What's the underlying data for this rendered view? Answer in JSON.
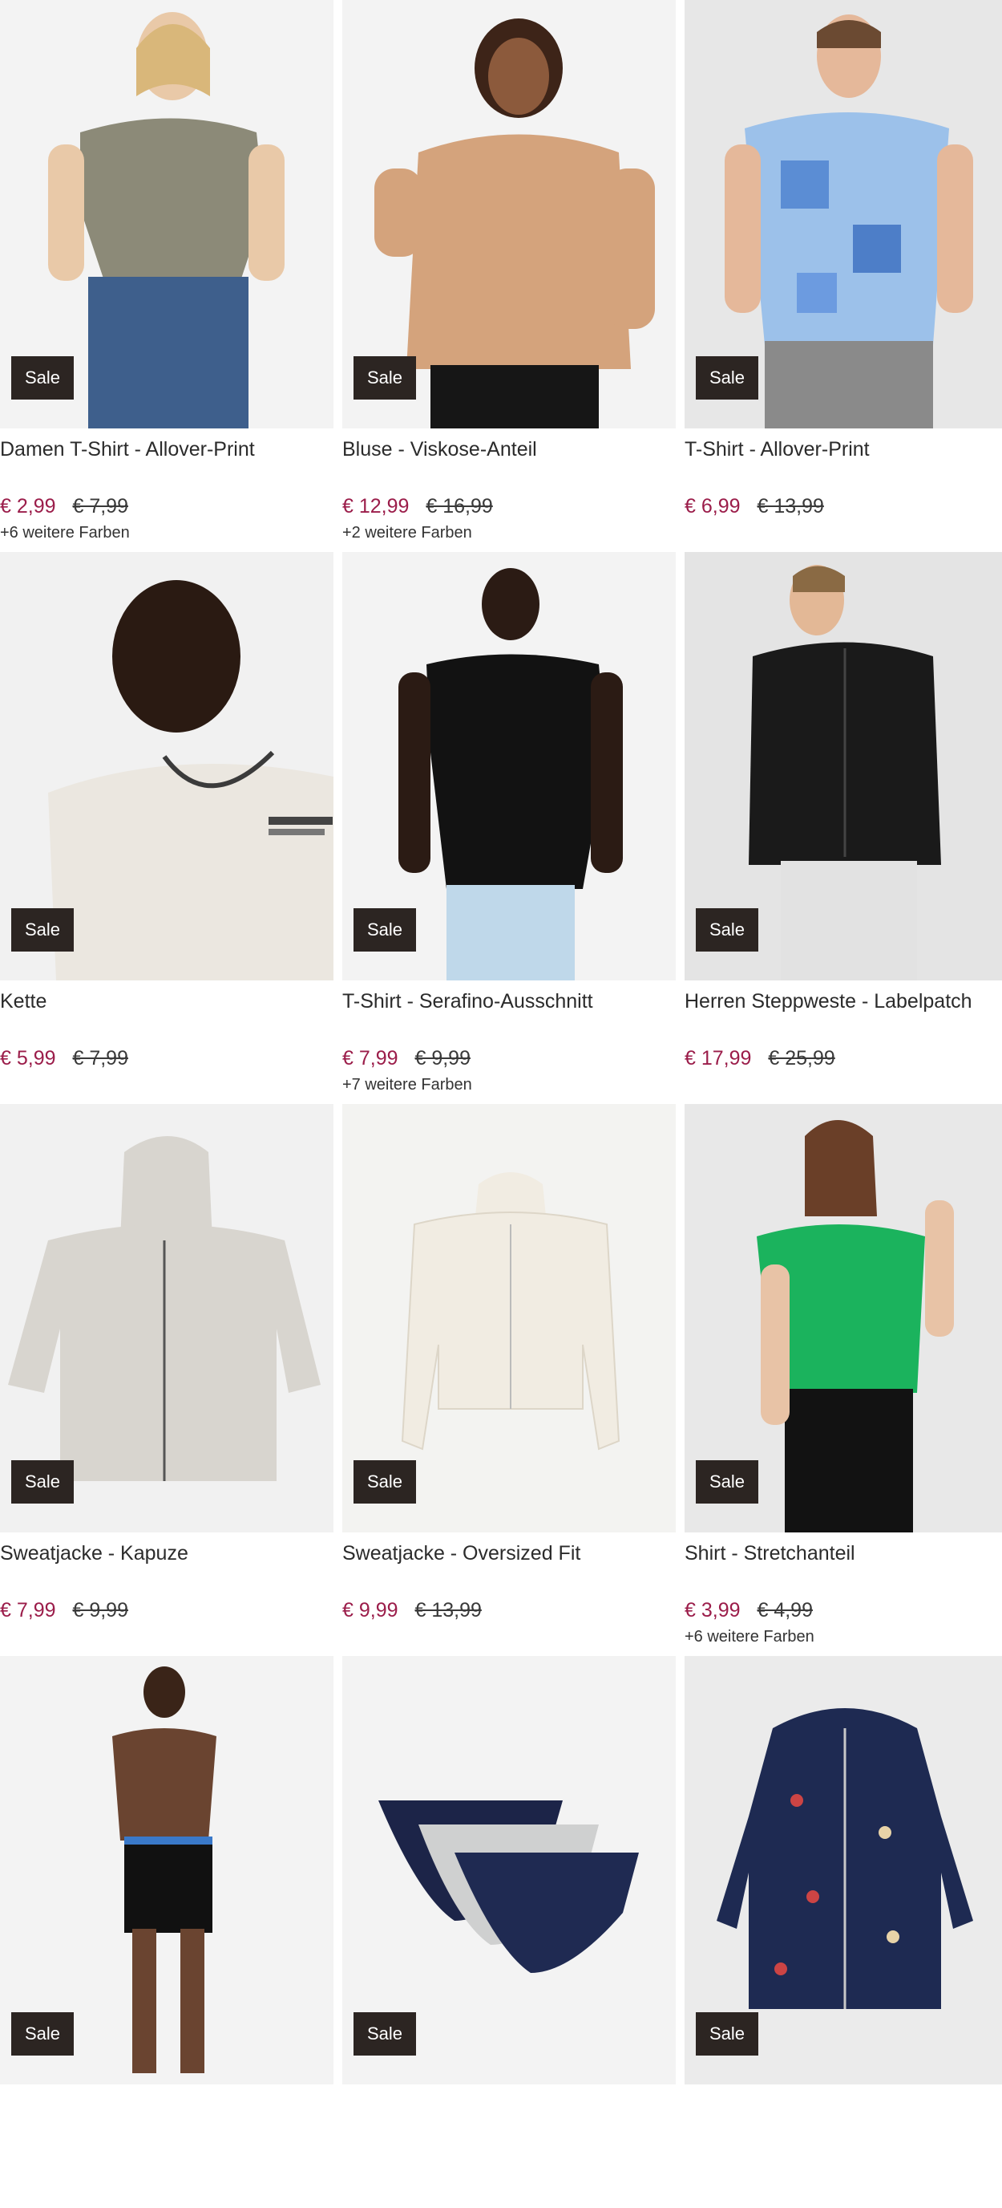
{
  "colors": {
    "sale_price": "#9b1d4a",
    "badge_bg": "#2c2522",
    "image_bg": "#f1f1f1"
  },
  "products": [
    {
      "title": "Damen T-Shirt - Allover-Print",
      "badge": "Sale",
      "price": "€ 2,99",
      "old_price": "€ 7,99",
      "more_colors": "+6 weitere Farben",
      "image": "model-grey-floral-tshirt-jeans"
    },
    {
      "title": "Bluse - Viskose-Anteil",
      "badge": "Sale",
      "price": "€ 12,99",
      "old_price": "€ 16,99",
      "more_colors": "+2 weitere Farben",
      "image": "model-beige-blouse"
    },
    {
      "title": "T-Shirt - Allover-Print",
      "badge": "Sale",
      "price": "€ 6,99",
      "old_price": "€ 13,99",
      "more_colors": "",
      "image": "model-blue-bandana-tshirt"
    },
    {
      "title": "Kette",
      "badge": "Sale",
      "price": "€ 5,99",
      "old_price": "€ 7,99",
      "more_colors": "",
      "image": "model-necklace-white-tshirt"
    },
    {
      "title": "T-Shirt - Serafino-Ausschnitt",
      "badge": "Sale",
      "price": "€ 7,99",
      "old_price": "€ 9,99",
      "more_colors": "+7 weitere Farben",
      "image": "model-black-tshirt"
    },
    {
      "title": "Herren Steppweste - Labelpatch",
      "badge": "Sale",
      "price": "€ 17,99",
      "old_price": "€ 25,99",
      "more_colors": "",
      "image": "model-black-quilted-vest"
    },
    {
      "title": "Sweatjacke - Kapuze",
      "badge": "Sale",
      "price": "€ 7,99",
      "old_price": "€ 9,99",
      "more_colors": "",
      "image": "grey-zip-hoodie"
    },
    {
      "title": "Sweatjacke - Oversized Fit",
      "badge": "Sale",
      "price": "€ 9,99",
      "old_price": "€ 13,99",
      "more_colors": "",
      "image": "cream-cropped-zip-jacket"
    },
    {
      "title": "Shirt - Stretchanteil",
      "badge": "Sale",
      "price": "€ 3,99",
      "old_price": "€ 4,99",
      "more_colors": "+6 weitere Farben",
      "image": "model-green-tshirt"
    },
    {
      "title": "",
      "badge": "Sale",
      "price": "",
      "old_price": "",
      "more_colors": "",
      "image": "model-boxer-shorts"
    },
    {
      "title": "",
      "badge": "Sale",
      "price": "",
      "old_price": "",
      "more_colors": "",
      "image": "three-pack-briefs"
    },
    {
      "title": "",
      "badge": "Sale",
      "price": "",
      "old_price": "",
      "more_colors": "",
      "image": "navy-printed-kids-jacket"
    }
  ]
}
